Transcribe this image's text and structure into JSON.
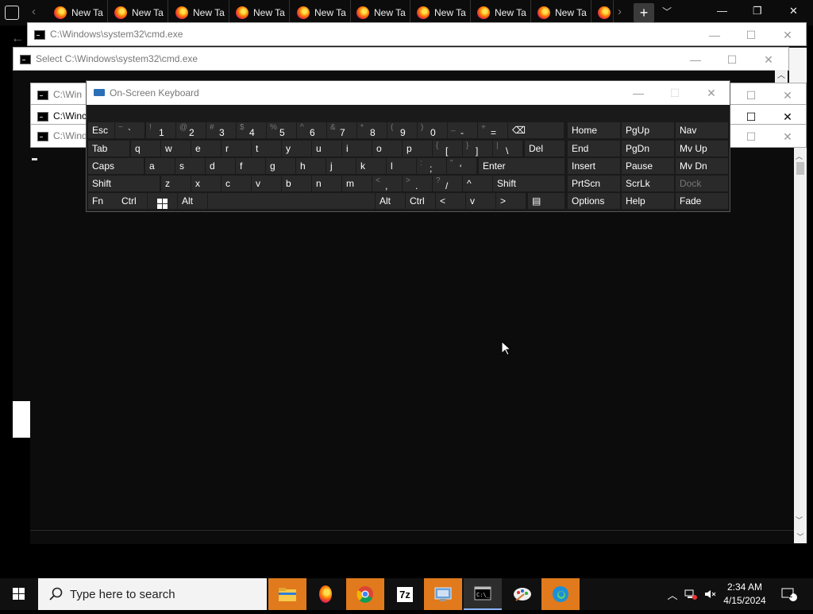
{
  "browser": {
    "tab_label": "New Ta",
    "tabs": [
      "New Ta",
      "New Ta",
      "New Ta",
      "New Ta",
      "New Ta",
      "New Ta",
      "New Ta",
      "New Ta",
      "New Ta"
    ],
    "new_tab_label": "+"
  },
  "windows": {
    "cmd_title_1": "C:\\Windows\\system32\\cmd.exe",
    "cmd_title_2": "Select C:\\Windows\\system32\\cmd.exe",
    "cmd_title_short": "C:\\Win",
    "cmd_title_short_2": "C:\\Winc",
    "cmd_title_short_3": "C:\\Wind"
  },
  "osk": {
    "title": "On-Screen Keyboard",
    "rows": [
      [
        {
          "label": "Esc"
        },
        {
          "shift": "~",
          "label": "`"
        },
        {
          "shift": "!",
          "label": "1"
        },
        {
          "shift": "@",
          "label": "2"
        },
        {
          "shift": "#",
          "label": "3"
        },
        {
          "shift": "$",
          "label": "4"
        },
        {
          "shift": "%",
          "label": "5"
        },
        {
          "shift": "^",
          "label": "6"
        },
        {
          "shift": "&",
          "label": "7"
        },
        {
          "shift": "*",
          "label": "8"
        },
        {
          "shift": "(",
          "label": "9"
        },
        {
          "shift": ")",
          "label": "0"
        },
        {
          "shift": "_",
          "label": "-"
        },
        {
          "shift": "+",
          "label": "="
        },
        {
          "label": "⌫"
        }
      ],
      [
        {
          "label": "Tab"
        },
        {
          "label": "q"
        },
        {
          "label": "w"
        },
        {
          "label": "e"
        },
        {
          "label": "r"
        },
        {
          "label": "t"
        },
        {
          "label": "y"
        },
        {
          "label": "u"
        },
        {
          "label": "i"
        },
        {
          "label": "o"
        },
        {
          "label": "p"
        },
        {
          "shift": "{",
          "label": "["
        },
        {
          "shift": "}",
          "label": "]"
        },
        {
          "shift": "|",
          "label": "\\"
        },
        {
          "label": "Del"
        }
      ],
      [
        {
          "label": "Caps"
        },
        {
          "label": "a"
        },
        {
          "label": "s"
        },
        {
          "label": "d"
        },
        {
          "label": "f"
        },
        {
          "label": "g"
        },
        {
          "label": "h"
        },
        {
          "label": "j"
        },
        {
          "label": "k"
        },
        {
          "label": "l"
        },
        {
          "shift": ":",
          "label": ";"
        },
        {
          "shift": "\"",
          "label": "'"
        },
        {
          "label": "Enter"
        }
      ],
      [
        {
          "label": "Shift"
        },
        {
          "label": "z"
        },
        {
          "label": "x"
        },
        {
          "label": "c"
        },
        {
          "label": "v"
        },
        {
          "label": "b"
        },
        {
          "label": "n"
        },
        {
          "label": "m"
        },
        {
          "shift": "<",
          "label": ","
        },
        {
          "shift": ">",
          "label": "."
        },
        {
          "shift": "?",
          "label": "/"
        },
        {
          "label": "^"
        },
        {
          "label": "Shift"
        }
      ],
      [
        {
          "label": "Fn"
        },
        {
          "label": "Ctrl"
        },
        {
          "label": ""
        },
        {
          "label": "Alt"
        },
        {
          "label": ""
        },
        {
          "label": "Alt"
        },
        {
          "label": "Ctrl"
        },
        {
          "label": "<"
        },
        {
          "label": "v"
        },
        {
          "label": ">"
        },
        {
          "label": "▤"
        }
      ]
    ],
    "nav_rows": [
      [
        "Home",
        "PgUp",
        "Nav"
      ],
      [
        "End",
        "PgDn",
        "Mv Up"
      ],
      [
        "Insert",
        "Pause",
        "Mv Dn"
      ],
      [
        "PrtScn",
        "ScrLk",
        "Dock"
      ],
      [
        "Options",
        "Help",
        "Fade"
      ]
    ]
  },
  "taskbar": {
    "search_placeholder": "Type here to search",
    "apps": [
      "file-explorer",
      "firefox",
      "chrome",
      "7-zip",
      "network-app",
      "command-prompt",
      "paint-app",
      "edge"
    ],
    "sevenzip_label": "7z",
    "time": "2:34 AM",
    "date": "4/15/2024",
    "notification_count": "2"
  }
}
